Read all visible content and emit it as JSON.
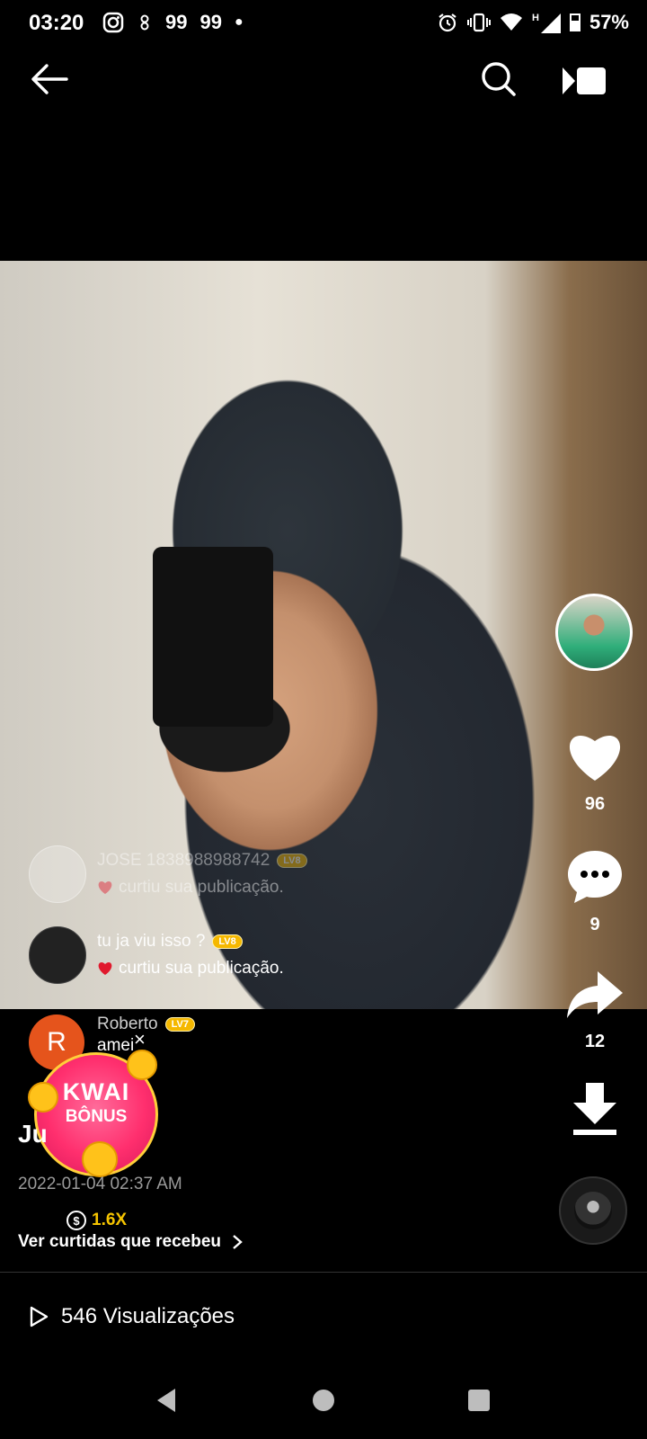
{
  "status_bar": {
    "time": "03:20",
    "notif_1": "99",
    "notif_2": "99",
    "battery": "57%"
  },
  "icons": {
    "back": "arrow-left-icon",
    "search": "search-icon",
    "stream": "stream-play-icon",
    "like": "heart-icon",
    "comment": "comment-bubble-icon",
    "share": "share-arrow-icon",
    "download": "download-icon"
  },
  "overlay_comments": [
    {
      "user": "JOSE 1838988988742",
      "level": "LV8",
      "action": "curtiu sua publicação."
    },
    {
      "user": "tu ja viu isso ?",
      "level": "LV8",
      "action": "curtiu sua publicação."
    }
  ],
  "rail": {
    "likes": "96",
    "comments": "9",
    "shares": "12"
  },
  "roberto": {
    "initial": "R",
    "name": "Roberto",
    "level": "LV7",
    "text": "amei"
  },
  "kwai_bonus": {
    "close": "×",
    "title": "KWAI",
    "subtitle": "BÔNUS"
  },
  "post": {
    "username_partial": "Ju",
    "timestamp": "2022-01-04 02:37 AM",
    "multiplier": "1.6X",
    "likes_received": "Ver curtidas que recebeu",
    "views": "546 Visualizações"
  },
  "colors": {
    "background": "#000000",
    "accent_red": "#ff2f6e",
    "gold": "#f5c400",
    "heart_red": "#e0192d"
  }
}
